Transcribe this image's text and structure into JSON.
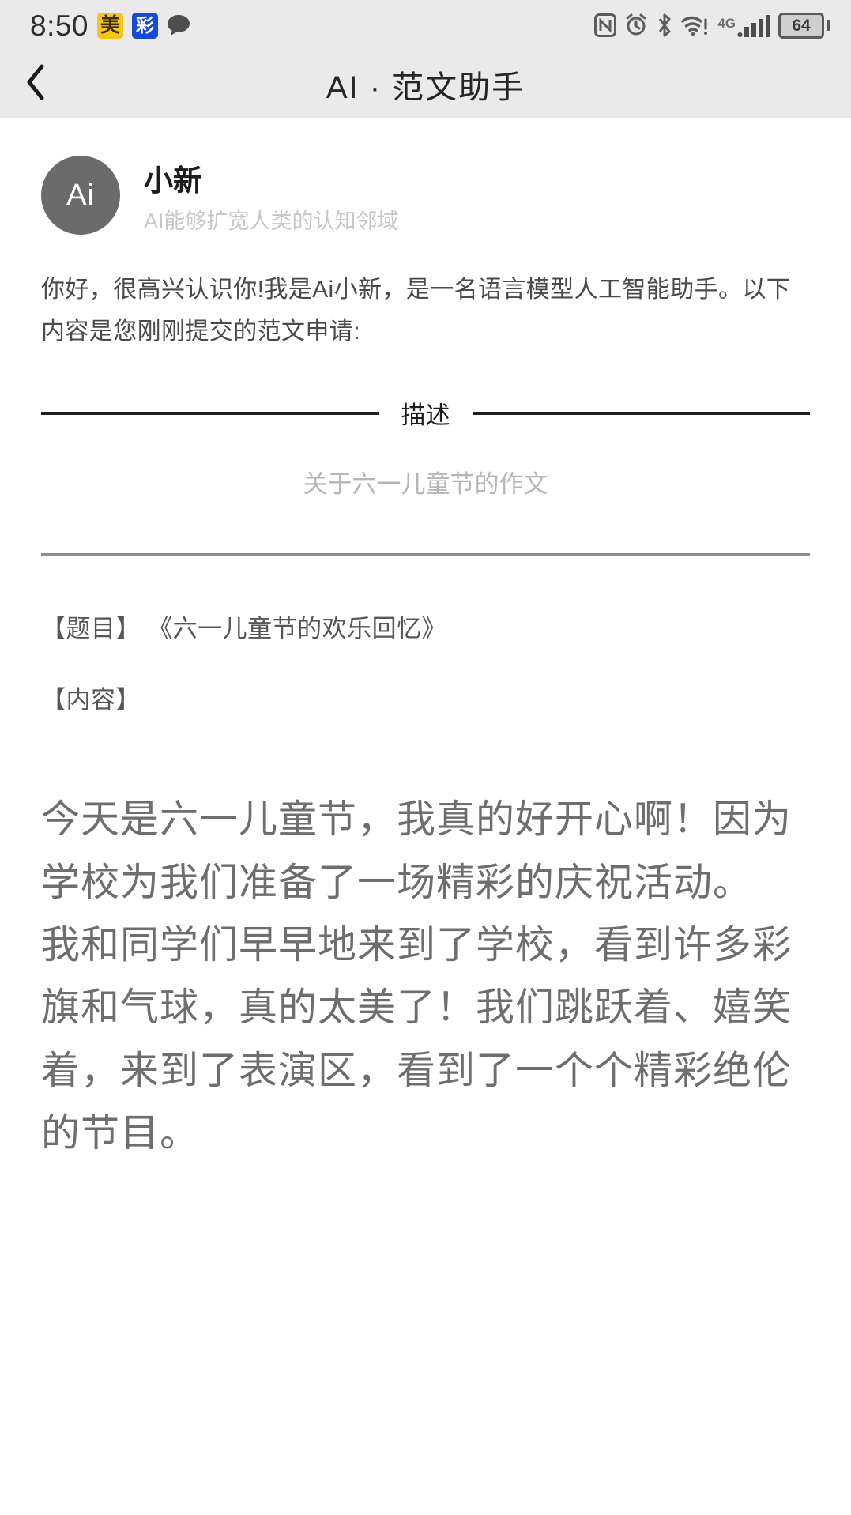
{
  "status_bar": {
    "time": "8:50",
    "app_badges": [
      {
        "name": "meituan-badge",
        "text": "美",
        "color": "#f5c518"
      },
      {
        "name": "blue-app-badge",
        "text": "彩",
        "color": "#1549d6"
      }
    ],
    "message_icon": "speech-bubble-icon",
    "icons": [
      "nfc-icon",
      "alarm-clock-icon",
      "bluetooth-icon",
      "wifi-warning-icon",
      "signal-4g-icon"
    ],
    "network_label": "4G",
    "battery_percent": "64"
  },
  "header": {
    "back_icon": "chevron-left-icon",
    "title": "AI · 范文助手"
  },
  "profile": {
    "avatar_text": "Ai",
    "name": "小新",
    "subtitle": "AI能够扩宽人类的认知邻域"
  },
  "greeting": "你好，很高兴认识你!我是Ai小新，是一名语言模型人工智能助手。以下内容是您刚刚提交的范文申请:",
  "description_section": {
    "divider_label": "描述",
    "value": "关于六一儿童节的作文"
  },
  "meta": {
    "title_line": "【题目】 《六一儿童节的欢乐回忆》",
    "content_line": "【内容】"
  },
  "essay": {
    "paragraph_1": "今天是六一儿童节，我真的好开心啊！因为学校为我们准备了一场精彩的庆祝活动。",
    "paragraph_2": "我和同学们早早地来到了学校，看到许多彩旗和气球，真的太美了！我们跳跃着、嬉笑着，来到了表演区，看到了一个个精彩绝伦的节目。"
  },
  "colors": {
    "chrome_bg": "#eaeaea",
    "page_bg": "#ffffff",
    "avatar_bg": "#6b6b6b",
    "body_text": "#6e6e6e",
    "muted_text": "#b6b6b6"
  }
}
